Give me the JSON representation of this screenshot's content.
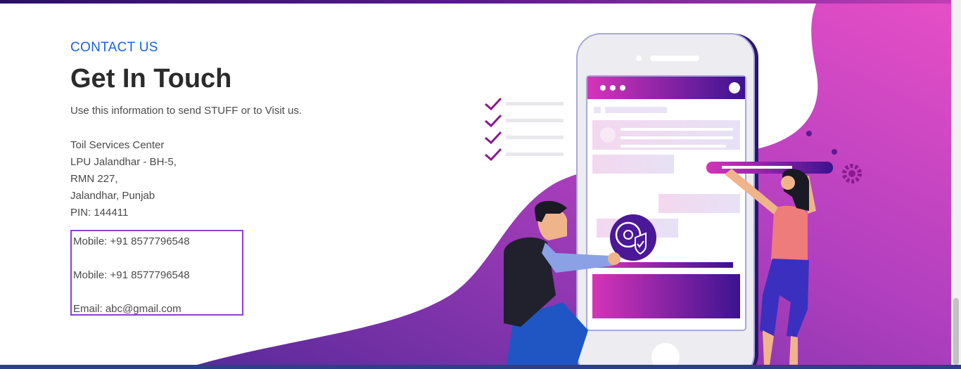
{
  "section": {
    "eyebrow": "CONTACT US",
    "title": "Get In Touch",
    "subtitle": "Use this information to send STUFF or to Visit us."
  },
  "address": {
    "lines": [
      "Toil Services Center",
      "LPU Jalandhar - BH-5,",
      "RMN 227,",
      "Jalandhar, Punjab",
      "PIN: 144411"
    ]
  },
  "contact": {
    "mobile1": "Mobile: +91 8577796548",
    "mobile2": "Mobile: +91 8577796548",
    "email": "Email: abc@gmail.com"
  },
  "colors": {
    "accent": "#1a63d6",
    "box_border": "#8a3fd6",
    "magenta": "#e24fc3",
    "purple": "#5b1a92"
  },
  "illustration": {
    "icon": "contact-us-illustration"
  }
}
